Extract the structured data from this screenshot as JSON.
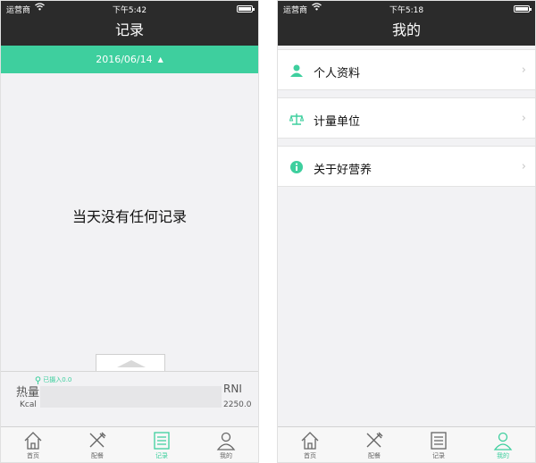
{
  "left_screen": {
    "status": {
      "carrier": "运营商",
      "time": "下午5:42"
    },
    "nav_title": "记录",
    "date": "2016/06/14",
    "empty_message": "当天没有任何记录",
    "summary": {
      "energy_label": "热量",
      "unit": "Kcal",
      "intake_label": "已摄入0.0",
      "rni_label": "RNI",
      "rni_value": "2250.0"
    },
    "tabs": [
      {
        "label": "首页",
        "active": false
      },
      {
        "label": "配餐",
        "active": false
      },
      {
        "label": "记录",
        "active": true
      },
      {
        "label": "我的",
        "active": false
      }
    ]
  },
  "right_screen": {
    "status": {
      "carrier": "运营商",
      "time": "下午5:18"
    },
    "nav_title": "我的",
    "menu": [
      {
        "label": "个人资料",
        "icon": "person-icon"
      },
      {
        "label": "计量单位",
        "icon": "scale-icon"
      },
      {
        "label": "关于好营养",
        "icon": "info-icon"
      }
    ],
    "tabs": [
      {
        "label": "首页",
        "active": false
      },
      {
        "label": "配餐",
        "active": false
      },
      {
        "label": "记录",
        "active": false
      },
      {
        "label": "我的",
        "active": true
      }
    ]
  },
  "colors": {
    "accent": "#3ecf9e",
    "header": "#2b2b2b",
    "background": "#f2f2f4"
  }
}
